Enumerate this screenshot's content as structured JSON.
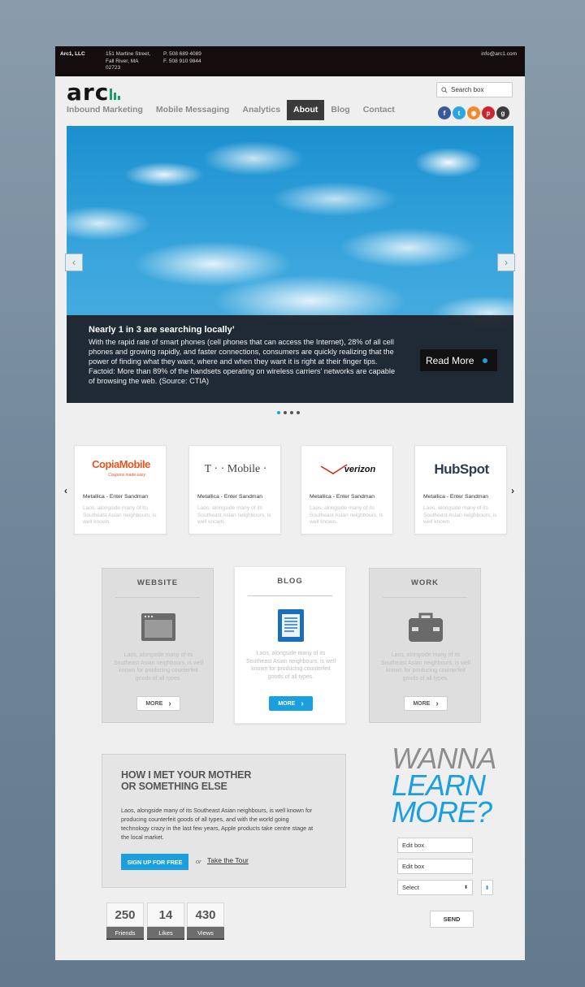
{
  "topbar": {
    "company": "Arc1, LLC",
    "address": [
      "151 Martine Street,",
      "Fall River, MA",
      "02723"
    ],
    "phone": "P. 508 689 4089",
    "fax": "F. 508 910 9844",
    "email": "info@arc1.com"
  },
  "logo": {
    "text": "arc"
  },
  "search": {
    "placeholder": "Search box"
  },
  "nav": {
    "items": [
      "Inbound Marketing",
      "Mobile Messaging",
      "Analytics",
      "About",
      "Blog",
      "Contact"
    ],
    "active": "About"
  },
  "social": [
    {
      "icon": "facebook-icon",
      "glyph": "f",
      "color": "#3b5998"
    },
    {
      "icon": "twitter-icon",
      "glyph": "t",
      "color": "#2aa7e0"
    },
    {
      "icon": "rss-icon",
      "glyph": "◉",
      "color": "#f0892a"
    },
    {
      "icon": "pinterest-icon",
      "glyph": "p",
      "color": "#d0232e"
    },
    {
      "icon": "google-plus-icon",
      "glyph": "g",
      "color": "#3c3c3c"
    }
  ],
  "hero": {
    "title": "Nearly 1 in 3 are searching locally’",
    "body": "With the rapid rate of smart phones (cell phones that can access the Internet), 28% of all cell phones and growing rapidly, and faster connections, consumers are quickly realizing that the power of finding what they want, where and when they want it is right at their finger tips. Factoid: More than 89% of the handsets operating on wireless carriers’ networks are capable of browsing the web. (Source: CTIA)",
    "read_more": "Read More",
    "slides": 4,
    "active_slide": 1
  },
  "clients": [
    {
      "brand": "CopiaMobile",
      "tagline": "Coupons made easy",
      "caption": "Metallica - Enter Sandman",
      "desc": "Laos, alongside many of its Southeast Asian neighbours, is well known."
    },
    {
      "brand": "T · · Mobile ·",
      "caption": "Metallica - Enter Sandman",
      "desc": "Laos, alongside many of its Southeast Asian neighbours, is well known."
    },
    {
      "brand": "verizon",
      "caption": "Metallica - Enter Sandman",
      "desc": "Laos, alongside many of its Southeast Asian neighbours, is well known."
    },
    {
      "brand": "HubSpot",
      "caption": "Metallica - Enter Sandman",
      "desc": "Laos, alongside many of its Southeast Asian neighbours, is well known."
    }
  ],
  "services": [
    {
      "title": "WEBSITE",
      "icon": "browser-window-icon",
      "text": "Laos, alongside many of its Southeast Asian neighbours, is well known for producing counterfeit goods of all types.",
      "more": "MORE"
    },
    {
      "title": "BLOG",
      "icon": "document-icon",
      "text": "Laos, alongside many of its Southeast Asian neighbours, is well known for producing counterfeit goods of all types.",
      "more": "MORE"
    },
    {
      "title": "WORK",
      "icon": "briefcase-icon",
      "text": "Laos, alongside many of its Southeast Asian neighbours, is well known for producing counterfeit goods of all types.",
      "more": "MORE"
    }
  ],
  "promo": {
    "heading_line1": "HOW I MET YOUR MOTHER",
    "heading_line2": "OR SOMETHING ELSE",
    "body": "Laos, alongside many of its Southeast Asian neighbours, is well known for producing counterfeit goods of all types, and with the world going technology crazy in the last few years, Apple products take centre stage at the local market.",
    "signup": "SIGN UP FOR FREE",
    "or": "or",
    "tour": "Take the Tour"
  },
  "cta": {
    "line1": "WANNA",
    "line2": "LEARN",
    "line3": "MORE?"
  },
  "form": {
    "field1": "Edit box",
    "field2": "Edit box",
    "select": "Select",
    "send": "SEND"
  },
  "stats": [
    {
      "value": "250",
      "label": "Friends"
    },
    {
      "value": "14",
      "label": "Likes"
    },
    {
      "value": "430",
      "label": "Views"
    }
  ],
  "colors": {
    "accent": "#1aa0e0",
    "logo_bars": "#16a26a",
    "topbar": "#150d0d"
  }
}
